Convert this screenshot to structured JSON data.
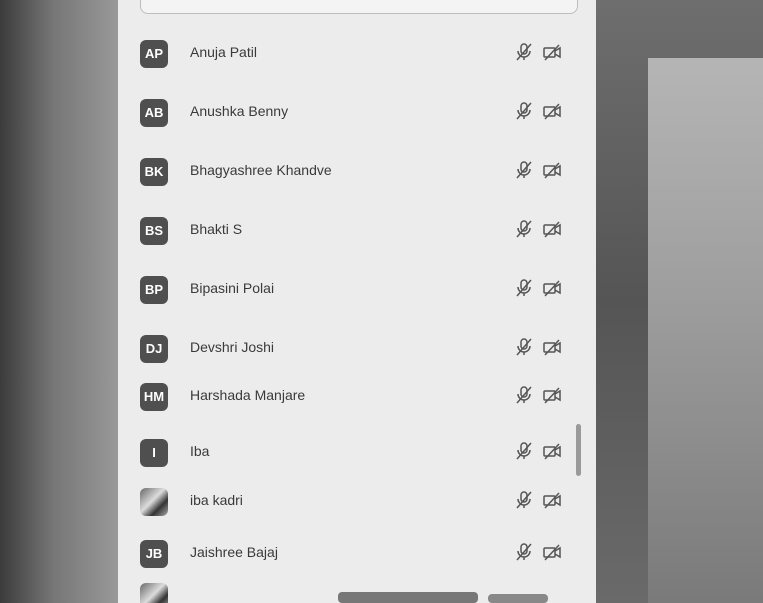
{
  "participants": [
    {
      "initials": "AP",
      "name": "Anuja Patil"
    },
    {
      "initials": "AB",
      "name": "Anushka Benny"
    },
    {
      "initials": "BK",
      "name": "Bhagyashree Khandve"
    },
    {
      "initials": "BS",
      "name": "Bhakti S"
    },
    {
      "initials": "BP",
      "name": "Bipasini Polai"
    },
    {
      "initials": "DJ",
      "name": "Devshri Joshi"
    },
    {
      "initials": "HM",
      "name": "Harshada Manjare"
    },
    {
      "initials": "I",
      "name": "Iba"
    },
    {
      "initials": "",
      "name": "iba kadri"
    },
    {
      "initials": "JB",
      "name": "Jaishree Bajaj"
    }
  ],
  "icons": {
    "mic": "microphone-muted-icon",
    "camera": "camera-off-icon"
  },
  "colors": {
    "panel": "#ececec",
    "avatar": "#4f4f4f",
    "text": "#3a3a3a"
  }
}
